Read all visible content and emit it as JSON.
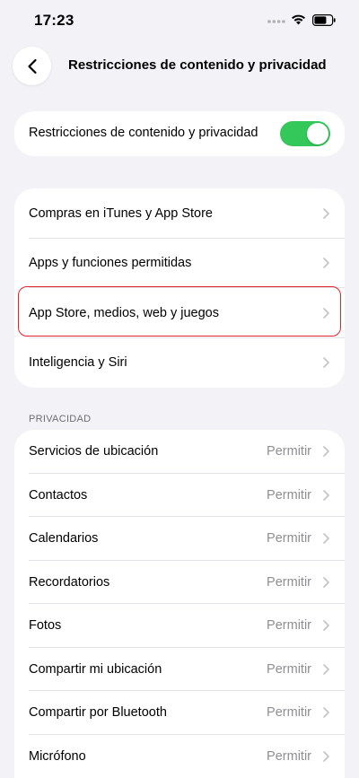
{
  "status_bar": {
    "time": "17:23"
  },
  "nav": {
    "title": "Restricciones de contenido y privacidad"
  },
  "toggle": {
    "label": "Restricciones de contenido y privacidad",
    "on": true
  },
  "group1": {
    "items": [
      {
        "label": "Compras en iTunes y App Store"
      },
      {
        "label": "Apps y funciones permitidas"
      },
      {
        "label": "App Store, medios, web y juegos"
      },
      {
        "label": "Inteligencia y Siri"
      }
    ]
  },
  "privacy": {
    "header": "PRIVACIDAD",
    "items": [
      {
        "label": "Servicios de ubicación",
        "value": "Permitir"
      },
      {
        "label": "Contactos",
        "value": "Permitir"
      },
      {
        "label": "Calendarios",
        "value": "Permitir"
      },
      {
        "label": "Recordatorios",
        "value": "Permitir"
      },
      {
        "label": "Fotos",
        "value": "Permitir"
      },
      {
        "label": "Compartir mi ubicación",
        "value": "Permitir"
      },
      {
        "label": "Compartir por Bluetooth",
        "value": "Permitir"
      },
      {
        "label": "Micrófono",
        "value": "Permitir"
      }
    ]
  },
  "colors": {
    "accent_toggle": "#34c759",
    "highlight": "#e0222a",
    "background": "#f2f2f7"
  }
}
